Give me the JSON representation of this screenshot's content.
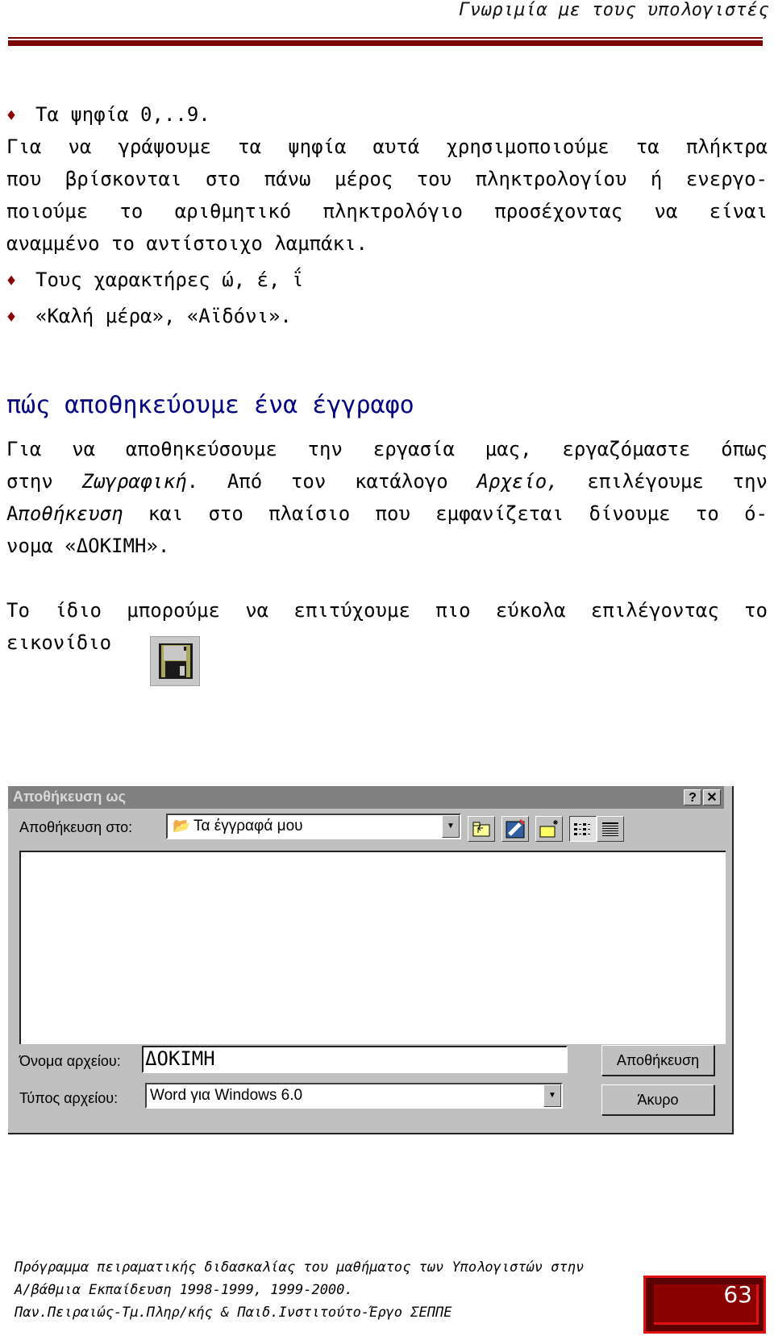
{
  "header": {
    "title": "Γνωριμία με τους υπολογιστές"
  },
  "list1": {
    "item1": "Τα ψηφία 0,..9.",
    "para_lines": [
      "Για να γράψουμε τα ψηφία αυτά χρησιμοποιούμε τα πλήκτρα",
      "που βρίσκονται στο πάνω μέρος του πληκτρολογίου ή ενεργο-",
      "ποιούμε το αριθμητικό πληκτρολόγιο προσέχοντας να είναι"
    ],
    "para_last": "αναμμένο το αντίστοιχο λαμπάκι.",
    "item2": "Τους χαρακτήρες ώ, έ, ΐ",
    "item3": "«Καλή μέρα», «Αϊδόνι»."
  },
  "section": {
    "heading": "πώς αποθηκεύουμε ένα έγγραφο",
    "p1_line1": "Για να αποθηκεύσουμε την εργασία μας, εργαζόμαστε όπως",
    "p1_line2_a": "στην ",
    "p1_line2_b": "Ζωγραφική",
    "p1_line2_c": ". Από τον κατάλογο ",
    "p1_line2_d": "Αρχείο,",
    "p1_line2_e": " επιλέγουμε την",
    "p1_line3_a": "Α",
    "p1_line3_b": "ποθήκευση",
    "p1_line3_c": "  και στο πλαίσιο που εμφανίζεται δίνουμε το ό-",
    "p1_line4": "νομα «ΔΟΚΙΜΗ».",
    "p2_line1": "Το ίδιο μπορούμε να επιτύχουμε πιο εύκολα επιλέγοντας το",
    "p2_line2": "εικονίδιο"
  },
  "dialog": {
    "title": "Αποθήκευση ως",
    "help_label": "?",
    "close_label": "✕",
    "save_in_label": "Αποθήκευση στο:",
    "save_in_value": "Τα έγγραφά μου",
    "filename_label": "Όνομα αρχείου:",
    "filename_value": "ΔΟΚΙΜΗ",
    "filetype_label": "Τύπος αρχείου:",
    "filetype_value": "Word για Windows 6.0",
    "save_button": "Αποθήκευση",
    "cancel_button": "Άκυρο"
  },
  "footer": {
    "line1": "Πρόγραμμα πειραματικής διδασκαλίας του μαθήματος των Υπολογιστών στην",
    "line2": "Α/βάθμια Εκπαίδευση 1998-1999, 1999-2000.",
    "line3": "Παν.Πειραιώς-Τμ.Πληρ/κής & Παιδ.Ινστιτούτο-Έργο ΣΕΠΠΕ",
    "page_number": "63"
  },
  "colors": {
    "accent": "#7a0000",
    "heading": "#000080",
    "dialog_bg": "#c0c0c0"
  }
}
